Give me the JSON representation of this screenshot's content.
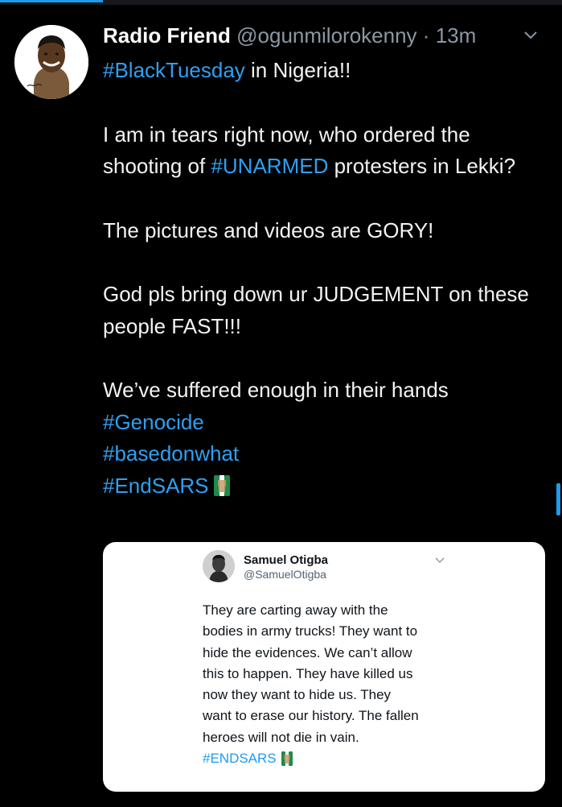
{
  "colors": {
    "background": "#000000",
    "text": "#f1f3f4",
    "hashtag": "#2ea0f2",
    "muted": "#8b98a5",
    "card": "#ffffff",
    "card_text": "#0f1419",
    "card_hashtag": "#1d9bf0"
  },
  "tweet": {
    "display_name": "Radio Friend",
    "handle": "@ogunmilorokenny",
    "separator": "·",
    "time": "13m",
    "menu_icon": "chevron-down-icon",
    "line1_tag": "#BlackTuesday",
    "line1_rest": " in Nigeria!!",
    "para1_pre": "I am in tears right now, who ordered the shooting of ",
    "para1_tag": "#UNARMED",
    "para1_post": " protesters in Lekki?",
    "para2": "The pictures and videos are GORY!",
    "para3": "God pls bring down ur JUDGEMENT on these people FAST!!!",
    "para4": "We’ve suffered enough in their hands",
    "tag_genocide": "#Genocide",
    "tag_basedonwhat": "#basedonwhat",
    "tag_endsars": "#EndSARS",
    "emoji_icon": "raised-fist-icon"
  },
  "embedded": {
    "name": "Samuel Otigba",
    "handle": "@SamuelOtigba",
    "lines": [
      "They are carting away with the",
      "bodies in army trucks! They want to",
      "hide the evidences. We can’t allow",
      "this to happen. They have killed us",
      "now they want to hide us. They",
      "want to erase our history. The fallen",
      "heroes will not die in vain."
    ],
    "hashtag": "#ENDSARS",
    "emoji_icon": "raised-fist-icon",
    "menu_icon": "chevron-down-icon"
  }
}
